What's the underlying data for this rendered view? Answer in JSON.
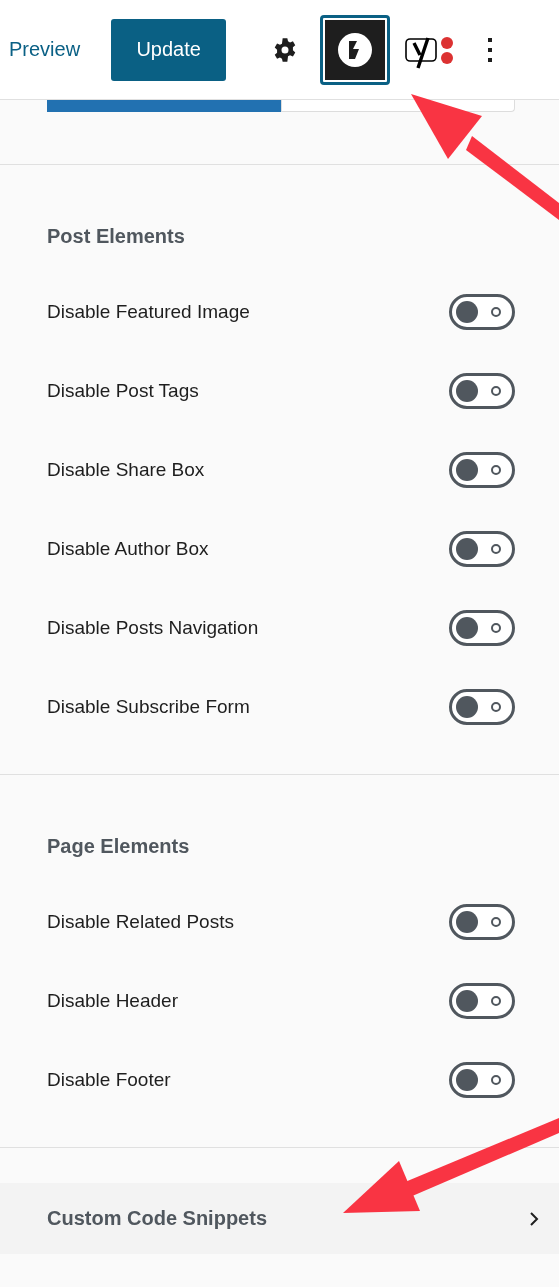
{
  "header": {
    "preview_link": "Preview",
    "update_button": "Update",
    "plugin_button_selected": true
  },
  "panel_tabs": [
    {
      "selected": true
    },
    {
      "selected": false
    }
  ],
  "sections": [
    {
      "title": "Post Elements",
      "toggles": [
        {
          "label": "Disable Featured Image",
          "on": false
        },
        {
          "label": "Disable Post Tags",
          "on": false
        },
        {
          "label": "Disable Share Box",
          "on": false
        },
        {
          "label": "Disable Author Box",
          "on": false
        },
        {
          "label": "Disable Posts Navigation",
          "on": false
        },
        {
          "label": "Disable Subscribe Form",
          "on": false
        }
      ]
    },
    {
      "title": "Page Elements",
      "toggles": [
        {
          "label": "Disable Related Posts",
          "on": false
        },
        {
          "label": "Disable Header",
          "on": false
        },
        {
          "label": "Disable Footer",
          "on": false
        }
      ]
    }
  ],
  "nav_item": {
    "label": "Custom Code Snippets"
  }
}
